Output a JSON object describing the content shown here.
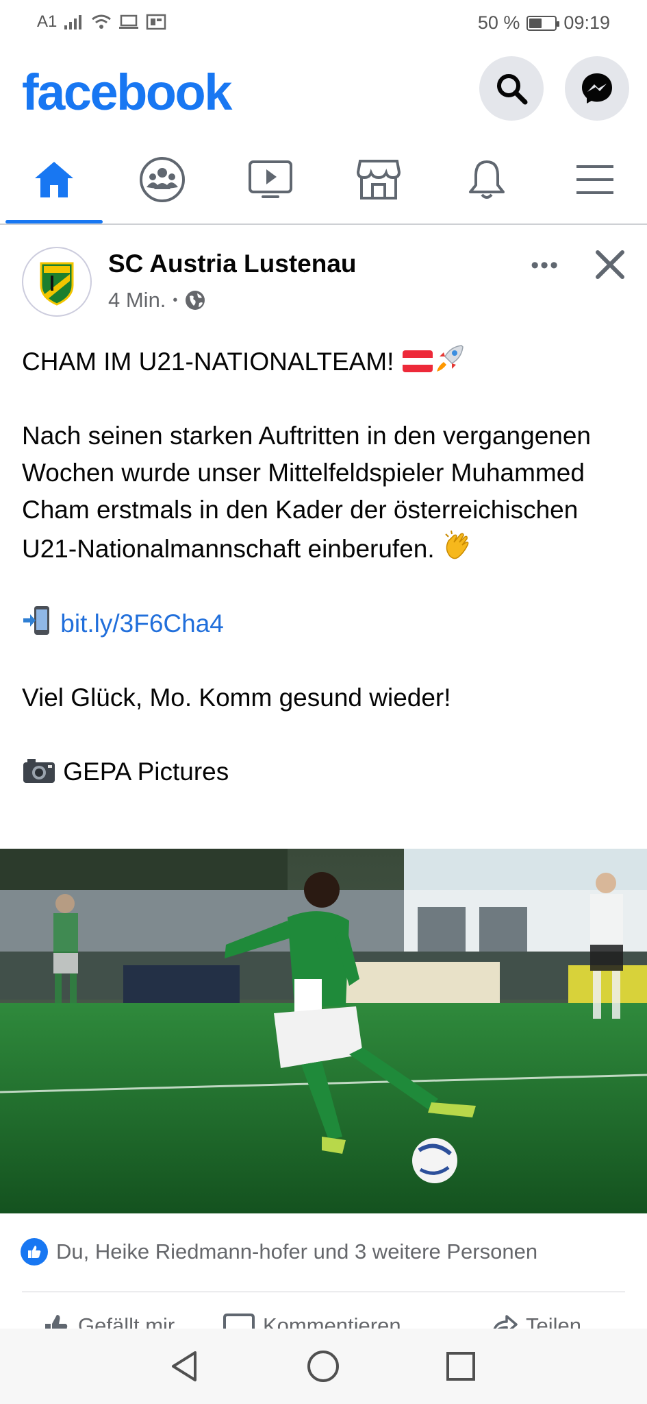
{
  "status_bar": {
    "carrier": "A1",
    "battery_text": "50 %",
    "battery_level": 0.5,
    "time": "09:19",
    "icons": [
      "signal-icon",
      "wifi-icon",
      "laptop-icon",
      "data-saver-icon"
    ]
  },
  "header": {
    "logo": "facebook",
    "brand_color": "#1877f2",
    "search_icon": "search-icon",
    "messenger_icon": "messenger-icon"
  },
  "tabs": [
    {
      "name": "home",
      "icon": "home-icon",
      "active": true
    },
    {
      "name": "groups",
      "icon": "groups-icon",
      "active": false
    },
    {
      "name": "watch",
      "icon": "video-icon",
      "active": false
    },
    {
      "name": "marketplace",
      "icon": "store-icon",
      "active": false
    },
    {
      "name": "notifications",
      "icon": "bell-icon",
      "active": false
    },
    {
      "name": "menu",
      "icon": "menu-icon",
      "active": false
    }
  ],
  "post": {
    "page_name": "SC Austria Lustenau",
    "time": "4 Min.",
    "separator": "•",
    "audience_icon": "globe-icon",
    "more_label": "•••",
    "headline": "CHAM IM U21-NATIONALTEAM!",
    "headline_emojis": [
      "austria-flag-emoji",
      "rocket-emoji"
    ],
    "body_line": "Nach seinen starken Auftritten in den vergangenen Wochen wurde unser Mittelfeldspieler Muhammed Cham erstmals in den Kader der österreichischen U21-Nationalmannschaft einberufen.",
    "body_emoji": "clapping-hands-emoji",
    "link": "bit.ly/3F6Cha4",
    "link_emoji": "mobile-arrow-emoji",
    "wish": "Viel Glück, Mo. Komm gesund wieder!",
    "credit": "GEPA Pictures",
    "credit_emoji": "camera-emoji"
  },
  "reactions": {
    "text": "Du, Heike Riedmann-hofer und 3 weitere Personen",
    "icon": "like-icon"
  },
  "actions": [
    {
      "label": "Gefällt mir",
      "icon": "like-icon"
    },
    {
      "label": "Kommentieren",
      "icon": "comment-icon"
    },
    {
      "label": "Teilen",
      "icon": "share-icon"
    }
  ],
  "navigation": [
    "back-icon",
    "home-circle-icon",
    "recents-icon"
  ]
}
